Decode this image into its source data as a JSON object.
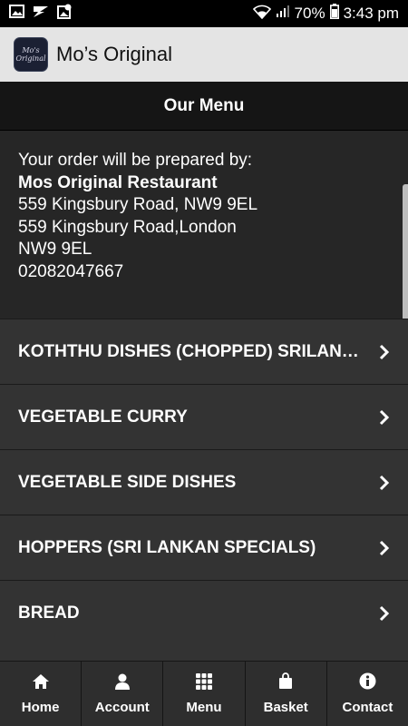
{
  "status_bar": {
    "battery": "70%",
    "time": "3:43 pm",
    "icons": [
      "gallery-icon",
      "notification-icon",
      "image-sync-icon",
      "wifi-icon",
      "signal-icon",
      "battery-icon"
    ]
  },
  "app_bar": {
    "title": "Mo’s Original",
    "logo_line1": "Mo's",
    "logo_line2": "Original"
  },
  "menu_header": {
    "title": "Our Menu"
  },
  "order_info": {
    "intro": "Your order will be prepared by:",
    "restaurant_name": "Mos Original Restaurant",
    "address_line1": "559 Kingsbury Road, NW9 9EL",
    "address_line2": "559 Kingsbury Road,London",
    "address_line3": "NW9 9EL",
    "phone": "02082047667"
  },
  "menu_items": [
    {
      "label": "KOTHTHU DISHES (CHOPPED) SRILANKAN SPECIALS"
    },
    {
      "label": "VEGETABLE CURRY"
    },
    {
      "label": "VEGETABLE SIDE DISHES"
    },
    {
      "label": "HOPPERS (SRI LANKAN SPECIALS)"
    },
    {
      "label": "BREAD"
    }
  ],
  "bottom_nav": {
    "home": "Home",
    "account": "Account",
    "menu": "Menu",
    "basket": "Basket",
    "contact": "Contact"
  },
  "colors": {
    "background": "#333333",
    "app_bar": "#e4e4e4",
    "header": "#151515",
    "info_panel": "#262626"
  }
}
